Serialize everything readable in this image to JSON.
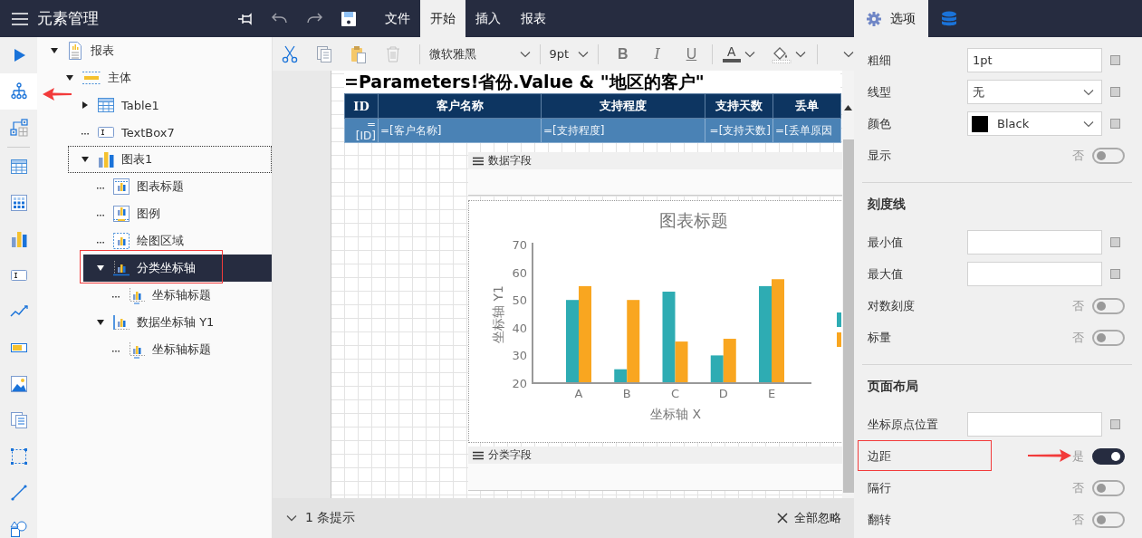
{
  "topbar": {
    "title": "元素管理",
    "quick_actions": [
      {
        "kind": "pin",
        "disabled": false
      },
      {
        "kind": "undo",
        "disabled": true
      },
      {
        "kind": "redo",
        "disabled": true
      },
      {
        "kind": "save",
        "disabled": false
      }
    ],
    "menu_tabs": [
      {
        "label": "文件",
        "selected": false
      },
      {
        "label": "开始",
        "selected": true
      },
      {
        "label": "插入",
        "selected": false
      },
      {
        "label": "报表",
        "selected": false
      }
    ]
  },
  "tool_rail": {
    "groups": [
      [
        {
          "kind": "run",
          "selected": false
        },
        {
          "kind": "outline",
          "selected": true,
          "annotated": true
        },
        {
          "kind": "grouping",
          "selected": false
        }
      ],
      [
        {
          "kind": "table",
          "selected": false
        },
        {
          "kind": "matrix",
          "selected": false
        },
        {
          "kind": "chart",
          "selected": false
        },
        {
          "kind": "textbox",
          "selected": false
        },
        {
          "kind": "sparkline",
          "selected": false
        },
        {
          "kind": "databar",
          "selected": false
        },
        {
          "kind": "image",
          "selected": false
        },
        {
          "kind": "subreport",
          "selected": false
        },
        {
          "kind": "container",
          "selected": false
        },
        {
          "kind": "line",
          "selected": false
        },
        {
          "kind": "shapes",
          "selected": false
        }
      ]
    ]
  },
  "tree": [
    {
      "label": "报表",
      "kind": "report",
      "expanded": true,
      "selected": false,
      "focused": false,
      "children": [
        {
          "label": "主体",
          "kind": "body",
          "expanded": true,
          "selected": false,
          "focused": false,
          "children": [
            {
              "label": "Table1",
              "kind": "table",
              "expanded": false,
              "selected": false,
              "focused": false
            },
            {
              "label": "TextBox7",
              "kind": "textbox",
              "selected": false,
              "focused": false
            },
            {
              "label": "图表1",
              "kind": "chart",
              "expanded": true,
              "selected": false,
              "focused": true,
              "children": [
                {
                  "label": "图表标题",
                  "kind": "chart-title",
                  "selected": false,
                  "focused": false
                },
                {
                  "label": "图例",
                  "kind": "legend",
                  "selected": false,
                  "focused": false
                },
                {
                  "label": "绘图区域",
                  "kind": "plot-area",
                  "selected": false,
                  "focused": false
                },
                {
                  "label": "分类坐标轴",
                  "kind": "category-axis",
                  "expanded": true,
                  "selected": true,
                  "focused": false,
                  "annotated": true,
                  "children": [
                    {
                      "label": "坐标轴标题",
                      "kind": "axis-title",
                      "selected": false,
                      "focused": false
                    }
                  ]
                },
                {
                  "label": "数据坐标轴 Y1",
                  "kind": "value-axis",
                  "expanded": true,
                  "selected": false,
                  "focused": false,
                  "children": [
                    {
                      "label": "坐标轴标题",
                      "kind": "axis-title",
                      "selected": false,
                      "focused": false
                    }
                  ]
                }
              ]
            }
          ]
        }
      ]
    }
  ],
  "toolbar": {
    "actions": [
      {
        "kind": "cut",
        "disabled": false
      },
      {
        "kind": "copy",
        "disabled": false
      },
      {
        "kind": "paste",
        "disabled": false
      },
      {
        "kind": "delete",
        "disabled": true
      }
    ],
    "font": "微软雅黑",
    "font_size": "9pt",
    "styles": [
      {
        "kind": "bold",
        "label": "B"
      },
      {
        "kind": "italic",
        "label": "I"
      },
      {
        "kind": "underline",
        "label": "U"
      }
    ],
    "font_color_label": "A"
  },
  "report": {
    "title": "=Parameters!省份.Value & \"地区的客户\"",
    "table": {
      "columns": [
        "ID",
        "客户名称",
        "支持程度",
        "支持天数",
        "丢单"
      ],
      "row": [
        "=[ID]",
        "=[客户名称]",
        "=[支持程度]",
        "=[支持天数]",
        "=[丢单原因"
      ]
    },
    "data_field_label": "数据字段",
    "chart": {
      "chart_data": {
        "type": "bar",
        "title": "图表标题",
        "xlabel": "坐标轴 X",
        "ylabel": "坐标轴 Y1",
        "categories": [
          "A",
          "B",
          "C",
          "D",
          "E"
        ],
        "series": [
          {
            "color": "#2eacb3",
            "values": [
              50,
              25,
              53,
              30,
              55
            ]
          },
          {
            "color": "#f9a620",
            "values": [
              55,
              50,
              35,
              36,
              57.5
            ]
          }
        ],
        "ylim": [
          20,
          70
        ],
        "yticks": [
          20,
          30,
          40,
          50,
          60,
          70
        ]
      }
    },
    "category_field_label": "分类字段"
  },
  "hint_bar": {
    "summary": "1 条提示",
    "dismiss_all": "全部忽略"
  },
  "properties": {
    "tabs": [
      {
        "kind": "options",
        "label": "选项",
        "selected": true
      },
      {
        "kind": "data",
        "selected": false
      }
    ],
    "sections": [
      {
        "rows": [
          {
            "kind": "input",
            "label": "粗细",
            "value": "1pt",
            "checked": false
          },
          {
            "kind": "select",
            "label": "线型",
            "value": "无",
            "checked": false
          },
          {
            "kind": "color",
            "label": "颜色",
            "value": "Black",
            "color": "#000000",
            "checked": false
          },
          {
            "kind": "toggle",
            "label": "显示",
            "on": false,
            "state_text": "否"
          }
        ]
      },
      {
        "title": "刻度线",
        "rows": [
          {
            "kind": "input",
            "label": "最小值",
            "checked": false
          },
          {
            "kind": "input",
            "label": "最大值",
            "checked": false
          },
          {
            "kind": "toggle",
            "label": "对数刻度",
            "on": false,
            "state_text": "否"
          },
          {
            "kind": "toggle",
            "label": "标量",
            "on": false,
            "state_text": "否"
          }
        ]
      },
      {
        "title": "页面布局",
        "rows": [
          {
            "kind": "input",
            "label": "坐标原点位置",
            "checked": false
          },
          {
            "kind": "toggle",
            "label": "边距",
            "on": true,
            "state_text": "是",
            "annotated": true
          },
          {
            "kind": "toggle",
            "label": "隔行",
            "on": false,
            "state_text": "否"
          },
          {
            "kind": "toggle",
            "label": "翻转",
            "on": false,
            "state_text": "否"
          }
        ]
      }
    ]
  }
}
